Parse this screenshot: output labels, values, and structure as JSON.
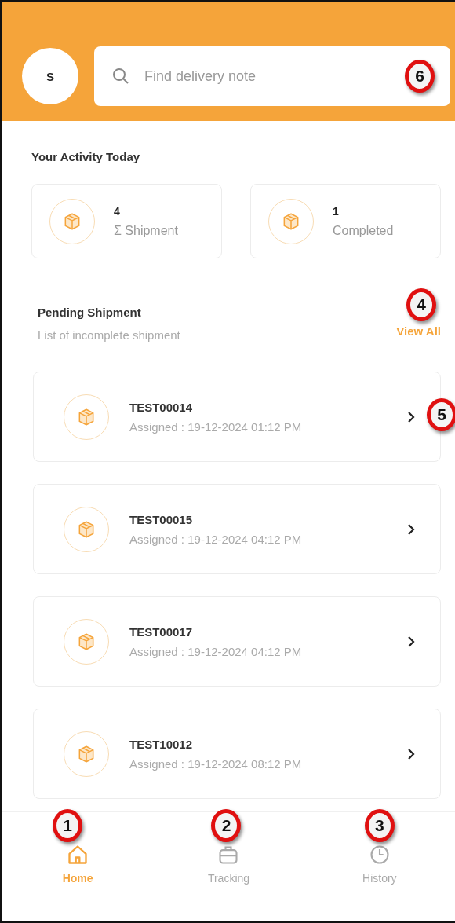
{
  "header": {
    "avatar": "S",
    "search": {
      "placeholder": "Find delivery note",
      "callout": "6"
    }
  },
  "activity": {
    "title": "Your Activity Today",
    "stats": [
      {
        "value": "4",
        "label": "Σ Shipment"
      },
      {
        "value": "1",
        "label": "Completed"
      }
    ]
  },
  "pending": {
    "title": "Pending Shipment",
    "subtitle": "List of incomplete shipment",
    "view_all": {
      "label": "View All",
      "callout": "4"
    },
    "shipments": [
      {
        "id": "TEST00014",
        "assigned": "Assigned : 19-12-2024 01:12 PM",
        "callout": "5"
      },
      {
        "id": "TEST00015",
        "assigned": "Assigned : 19-12-2024 04:12 PM"
      },
      {
        "id": "TEST00017",
        "assigned": "Assigned : 19-12-2024 04:12 PM"
      },
      {
        "id": "TEST10012",
        "assigned": "Assigned : 19-12-2024 08:12 PM"
      }
    ]
  },
  "nav": [
    {
      "label": "Home",
      "kind": "home",
      "selected": true,
      "callout": "1"
    },
    {
      "label": "Tracking",
      "kind": "briefcase",
      "selected": false,
      "callout": "2"
    },
    {
      "label": "History",
      "kind": "clock",
      "selected": false,
      "callout": "3"
    }
  ]
}
